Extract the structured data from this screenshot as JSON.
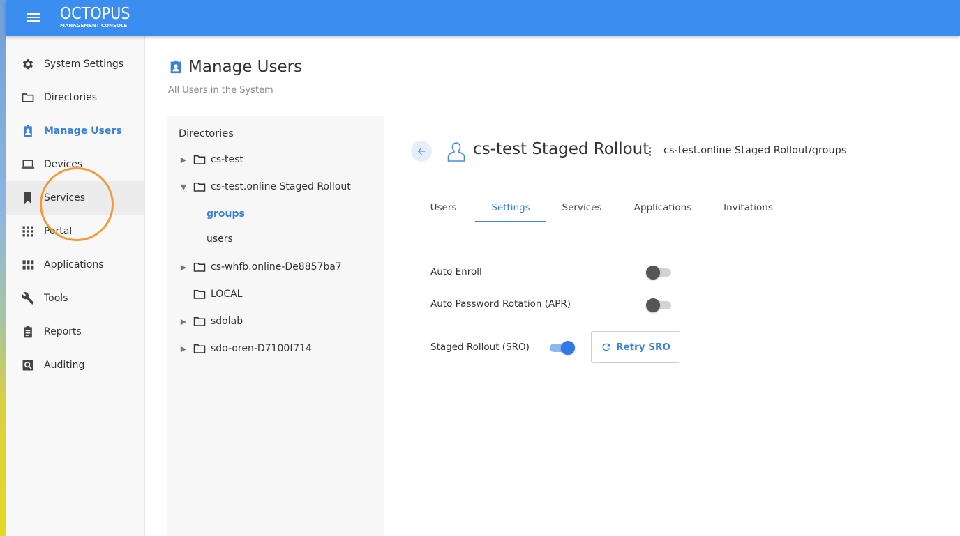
{
  "header": {
    "brand_name": "OCTOPUS",
    "brand_sub": "MANAGEMENT CONSOLE",
    "color": "#3b8ef0"
  },
  "sidebar": {
    "items": [
      {
        "label": "System Settings",
        "icon": "gear-icon"
      },
      {
        "label": "Directories",
        "icon": "folder-icon"
      },
      {
        "label": "Manage Users",
        "icon": "user-badge-icon",
        "active": true
      },
      {
        "label": "Devices",
        "icon": "laptop-icon"
      },
      {
        "label": "Services",
        "icon": "bookmark-icon",
        "hover": true
      },
      {
        "label": "Portal",
        "icon": "grid-icon"
      },
      {
        "label": "Applications",
        "icon": "apps-icon"
      },
      {
        "label": "Tools",
        "icon": "wrench-icon"
      },
      {
        "label": "Reports",
        "icon": "clipboard-icon"
      },
      {
        "label": "Auditing",
        "icon": "search-report-icon"
      }
    ]
  },
  "page": {
    "title": "Manage Users",
    "subtitle": "All Users in the System"
  },
  "directories": {
    "heading": "Directories",
    "tree": [
      {
        "label": "cs-test",
        "expandable": true,
        "expanded": false
      },
      {
        "label": "cs-test.online Staged Rollout",
        "expandable": true,
        "expanded": true,
        "children": [
          {
            "label": "groups",
            "selected": true
          },
          {
            "label": "users"
          }
        ]
      },
      {
        "label": "cs-whfb.online-De8857ba7",
        "expandable": true,
        "expanded": false
      },
      {
        "label": "LOCAL",
        "expandable": false
      },
      {
        "label": "sdolab",
        "expandable": true,
        "expanded": false
      },
      {
        "label": "sdo-oren-D7100f714",
        "expandable": true,
        "expanded": false
      }
    ]
  },
  "detail": {
    "title": "cs-test Staged Rollout",
    "path": "cs-test.online Staged Rollout/groups",
    "tabs": [
      {
        "label": "Users"
      },
      {
        "label": "Settings",
        "active": true
      },
      {
        "label": "Services"
      },
      {
        "label": "Applications"
      },
      {
        "label": "Invitations"
      }
    ],
    "settings": [
      {
        "label": "Auto Enroll",
        "enabled": false
      },
      {
        "label": "Auto Password Rotation (APR)",
        "enabled": false
      },
      {
        "label": "Staged Rollout (SRO)",
        "enabled": true
      }
    ],
    "retry_label": "Retry SRO"
  },
  "colors": {
    "accent": "#3b82d6",
    "click_ring": "#f39a3c"
  }
}
